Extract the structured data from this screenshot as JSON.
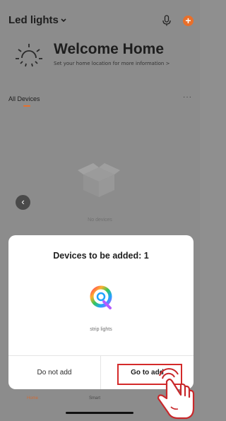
{
  "header": {
    "home_name": "Led lights",
    "icons": {
      "dropdown": "chevron-down-icon",
      "mic": "microphone-icon",
      "add": "plus-icon"
    },
    "accent_color": "#e86f2a"
  },
  "welcome": {
    "title": "Welcome Home",
    "subtitle": "Set your home location for more information >",
    "icon": "sun-icon"
  },
  "devices": {
    "tab_label": "All Devices",
    "more": "···",
    "empty_text": "No devices"
  },
  "modal": {
    "title": "Devices to be added: 1",
    "device_name": "strip lights",
    "device_icon": "strip-lights-icon",
    "cancel_label": "Do not add",
    "confirm_label": "Go to add"
  },
  "nav": {
    "home_label": "Home",
    "smart_label": "Smart"
  },
  "annotation": {
    "highlight_color": "#d42a2a",
    "pointer_icon": "tap-hand-icon"
  }
}
